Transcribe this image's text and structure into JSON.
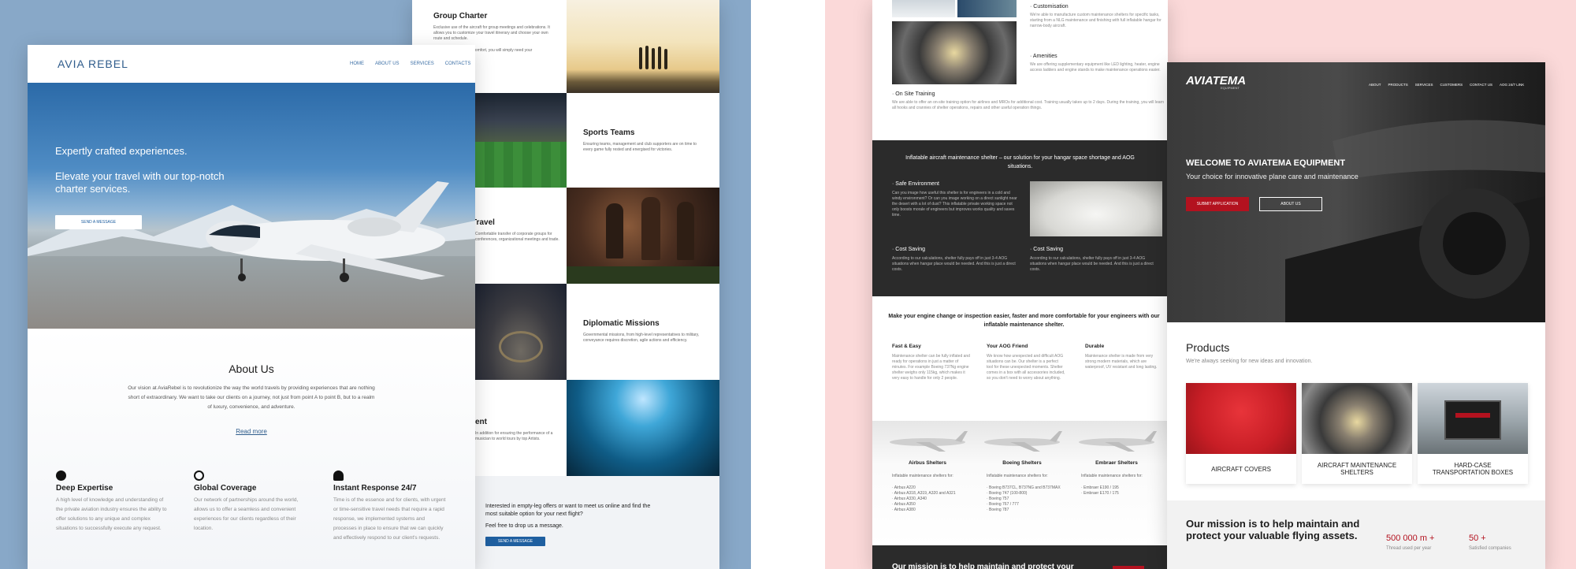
{
  "left": {
    "back": {
      "group_charter": {
        "title": "Group Charter",
        "body": "Exclusive use of the aircraft for group meetings and celebrations. It allows you to customize your travel itinerary and choose your own route and schedule.",
        "body2": "Guaranteed corporate comfort, you will simply need your experience."
      },
      "sports": {
        "title": "Sports Teams",
        "body": "Ensuring teams, management and club supporters are on time to every game fully rested and energised for victories."
      },
      "travel": {
        "title": "Travel",
        "body": "Comfortable transfer of corporate groups for conferences, organizational meetings and trade."
      },
      "diplomatic": {
        "title": "Diplomatic Missions",
        "body": "Governmental missions, from high-level representatives to military, conveyance requires discretion, agile actions and efficiency."
      },
      "ent": {
        "title": "ent",
        "body": "In addition for ensuring the performance of a musician to world tours by top Artists."
      },
      "empty_leg": {
        "line1": "Interested in empty-leg offers or want to meet us online and find the most suitable option for your next flight?",
        "line2": "Feel free to drop us a message.",
        "button": "SEND A MESSAGE"
      }
    },
    "front": {
      "logo": "AVIA REBEL",
      "nav": [
        "HOME",
        "ABOUT US",
        "SERVICES",
        "CONTACTS"
      ],
      "hero": {
        "line1": "Expertly crafted experiences.",
        "line2": "Elevate your travel with our top-notch charter services.",
        "button": "SEND A MESSAGE"
      },
      "about": {
        "title": "About Us",
        "body": "Our vision at AviaRebel is to revolutionize the way the world travels by providing experiences that are nothing short of extraordinary. We want to take our clients on a journey, not just from point A to point B, but to a realm of luxury, convenience, and adventure.",
        "link": "Read more"
      },
      "features": [
        {
          "title": "Deep Expertise",
          "body": "A high level of knowledge and understanding of the private aviation industry ensures the ability to offer solutions to any unique and complex situations to successfully execute any request.",
          "icon": "globe-pin-icon"
        },
        {
          "title": "Global Coverage",
          "body": "Our network of partnerships around the world, allows us to offer a seamless and convenient experiences for our clients regardless of their location.",
          "icon": "globe-icon"
        },
        {
          "title": "Instant Response 24/7",
          "body": "Time is of the essence and for clients, with urgent or time-sensitive travel needs that require a rapid response, we implemented systems and processes in place to ensure that we can quickly and effectively respond to our client's requests.",
          "icon": "support-agent-icon"
        }
      ]
    }
  },
  "right": {
    "left_page": {
      "customisation": {
        "title": "· Customisation",
        "body": "We're able to manufacture custom maintenance shelters for specific tasks, starting from a NLG maintenance and finishing with full inflatable hangar for narrow-body aircraft."
      },
      "amenities": {
        "title": "· Amenities",
        "body": "We are offering supplementary equipment like LED lighting, heater, engine access ladders and engine stands to make maintenance operations easier."
      },
      "training": {
        "title": "· On Site Training",
        "body": "We are able to offer an on-site training option for airlines and MROs for additional cost. Training usually takes up to 2 days. During the training, you will learn all hooks and crannies of shelter operations, repairs and other useful operation things."
      },
      "dark": {
        "title": "Inflatable aircraft maintenance shelter – our solution for your hangar space shortage and AOG situations.",
        "safe": {
          "title": "· Safe Environment",
          "body": "Can you image how useful this shelter is for engineers in a cold and windy environment? Or can you image working on a direct sunlight near the desert with a lot of dust? This inflatable private working space not only boosts morale of engineers but improves works quality and saves time."
        },
        "cost1": {
          "title": "· Cost Saving",
          "body": "According to our calculations, shelter fully pays off in just 3-4 AOG situations when hangar place would be needed. And this is just a direct costs."
        },
        "cost2": {
          "title": "· Cost Saving",
          "body": "According to our calculations, shelter fully pays off in just 3-4 AOG situations when hangar place would be needed. And this is just a direct costs."
        }
      },
      "engine": {
        "title": "Make your engine change or inspection easier, faster and more comfortable for your engineers with our inflatable maintenance shelter.",
        "cols": [
          {
            "title": "Fast & Easy",
            "body": "Maintenance shelter can be fully inflated and ready for operations in just a matter of minutes. For example Boeing 737Ng engine shelter weighs only 115kg, which makes it very easy to handle for only 2 people."
          },
          {
            "title": "Your AOG Friend",
            "body": "We know how unexpected and difficult AOG situations can be. Our shelter is a perfect tool for these unexpected moments. Shelter comes in a box with all accessories included, so you don't need to worry about anything."
          },
          {
            "title": "Durable",
            "body": "Maintenance shelter is made from very strong modern materials, which are waterproof, UV resistant and long lasting."
          }
        ]
      },
      "shelters": [
        {
          "title": "Airbus Shelters",
          "sub": "Inflatable maintenance shelters for:",
          "items": [
            "· Airbus A220",
            "· Airbus A318, A319, A320 and A321",
            "· Airbus A330, A340",
            "· Airbus A350",
            "· Airbus A380"
          ]
        },
        {
          "title": "Boeing Shelters",
          "sub": "Inflatable maintenance shelters for:",
          "items": [
            "· Boeing B737CL, B737NG and B737MAX",
            "· Boeing 747 (100-800)",
            "· Boeing 757",
            "· Boeing 767 / 777",
            "· Boeing 787"
          ]
        },
        {
          "title": "Embraer Shelters",
          "sub": "Inflatable maintenance shelters for:",
          "items": [
            "· Embraer E190 / 195",
            "· Embraer E170 / 175"
          ]
        }
      ],
      "footer_mission": "Our mission is to help maintain and protect your"
    },
    "front": {
      "logo": "AVIATEMA",
      "logo_sub": "EQUIPMENT",
      "nav": [
        "ABOUT",
        "PRODUCTS",
        "SERVICES",
        "CUSTOMERS",
        "CONTACT US",
        "AOG 24/7 LINK"
      ],
      "hero": {
        "title": "WELCOME TO AVIATEMA EQUIPMENT",
        "subtitle": "Your choice for innovative plane care and maintenance",
        "btn_primary": "SUBMIT APPLICATION",
        "btn_secondary": "ABOUT US"
      },
      "products": {
        "title": "Products",
        "subtitle": "We're always seeking for new ideas and innovation.",
        "items": [
          "AIRCRAFT COVERS",
          "AIRCRAFT MAINTENANCE SHELTERS",
          "HARD-CASE TRANSPORTATION BOXES"
        ]
      },
      "mission": {
        "title": "Our mission is to help maintain and protect your valuable flying assets.",
        "stat1_value": "500 000 m +",
        "stat1_label": "Thread used per year",
        "stat2_value": "50 +",
        "stat2_label": "Satisfied companies"
      }
    }
  },
  "colors": {
    "accent_blue": "#1f5fa0",
    "accent_red": "#b3121f",
    "dark_bg": "#2b2b2b"
  }
}
